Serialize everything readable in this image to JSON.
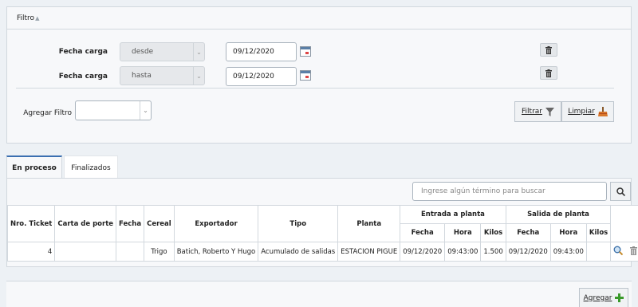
{
  "filter": {
    "title": "Filtro",
    "rows": [
      {
        "label": "Fecha carga",
        "operator": "desde",
        "date": "09/12/2020"
      },
      {
        "label": "Fecha carga",
        "operator": "hasta",
        "date": "09/12/2020"
      }
    ],
    "add_filter_label": "Agregar Filtro",
    "add_filter_value": "",
    "filter_button": "Filtrar",
    "clear_button": "Limpiar"
  },
  "tabs": [
    {
      "label": "En proceso",
      "active": true
    },
    {
      "label": "Finalizados",
      "active": false
    }
  ],
  "search": {
    "placeholder": "Ingrese algún término para buscar"
  },
  "table": {
    "headers": {
      "nro_ticket": "Nro. Ticket",
      "carta_porte": "Carta de porte",
      "fecha": "Fecha",
      "cereal": "Cereal",
      "exportador": "Exportador",
      "tipo": "Tipo",
      "planta": "Planta",
      "entrada": "Entrada a planta",
      "salida": "Salida de planta",
      "sub_fecha": "Fecha",
      "sub_hora": "Hora",
      "sub_kilos": "Kilos"
    },
    "rows": [
      {
        "nro_ticket": "4",
        "carta_porte": "",
        "fecha": "",
        "cereal": "Trigo",
        "exportador": "Batich, Roberto Y Hugo",
        "tipo": "Acumulado de salidas",
        "planta": "ESTACION PIGUE",
        "entrada_fecha": "09/12/2020",
        "entrada_hora": "09:43:00",
        "entrada_kilos": "1.500",
        "salida_fecha": "09/12/2020",
        "salida_hora": "09:43:00",
        "salida_kilos": ""
      }
    ]
  },
  "footer": {
    "add_button": "Agregar"
  },
  "colors": {
    "accent": "#3b6fb0",
    "panel": "#f7f8fa",
    "background": "#edf1f5"
  }
}
